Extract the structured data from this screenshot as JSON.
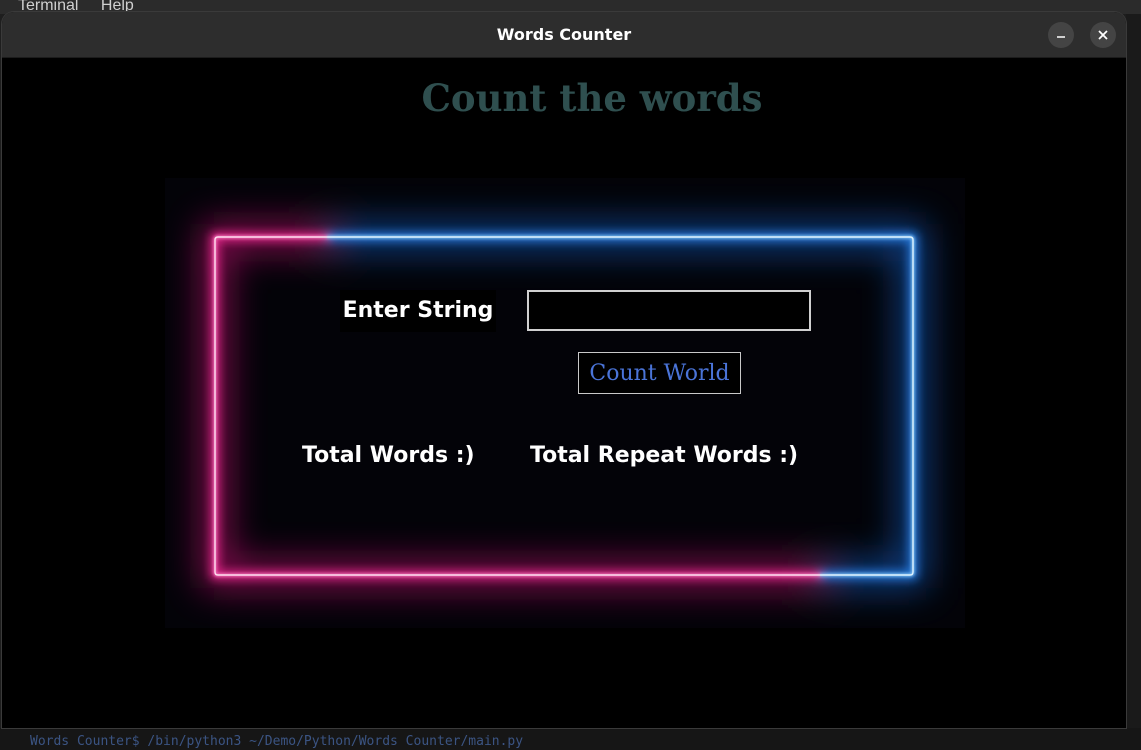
{
  "desktop": {
    "menu": [
      "Terminal",
      "Help"
    ],
    "bottom_text": "Words Counter$ /bin/python3 ~/Demo/Python/Words Counter/main.py"
  },
  "window": {
    "title": "Words Counter",
    "minimize_icon": "minimize-icon",
    "close_icon": "close-icon"
  },
  "app": {
    "heading": "Count the words",
    "heading_color": "#2f4f4f",
    "enter_string_label": "Enter String",
    "input_value": "",
    "count_button_label": "Count World",
    "count_button_color": "#4a74d8",
    "total_words_label": "Total Words :)",
    "total_repeat_label": "Total Repeat Words :)"
  },
  "neon_frame": {
    "pink_color": "#ff1493",
    "blue_color": "#2196ff"
  }
}
